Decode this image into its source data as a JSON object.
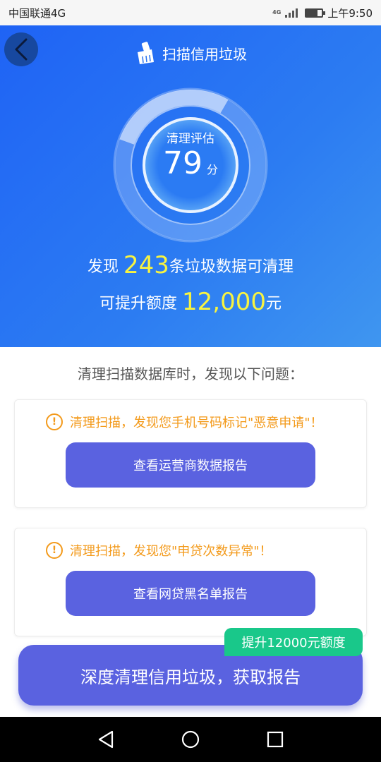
{
  "status_bar": {
    "carrier": "中国联通4G",
    "network_type": "4G",
    "battery_level": 0.7,
    "time": "上午9:50"
  },
  "header": {
    "title": "扫描信用垃圾",
    "icon": "broom-icon",
    "back_icon": "chevron-left-icon"
  },
  "gauge": {
    "label": "清理评估",
    "score": "79",
    "unit": "分"
  },
  "summary": {
    "found_prefix": "发现",
    "found_count": "243",
    "found_suffix": "条垃圾数据可清理",
    "credit_prefix": "可提升额度",
    "credit_amount": "12,000",
    "credit_suffix": "元"
  },
  "section_title": "清理扫描数据库时，发现以下问题：",
  "issues": [
    {
      "warning": "清理扫描，发现您手机号码标记\"恶意申请\"！",
      "button": "查看运营商数据报告"
    },
    {
      "warning": "清理扫描，发现您\"申贷次数异常\"！",
      "button": "查看网贷黑名单报告"
    }
  ],
  "cta": {
    "label": "深度清理信用垃圾，获取报告",
    "badge": "提升12000元额度"
  },
  "colors": {
    "hero_start": "#1f63f5",
    "hero_end": "#3f96f0",
    "highlight": "#f7f341",
    "button": "#5a62e0",
    "warning": "#f39a1b",
    "badge": "#19c88a"
  },
  "nav": [
    "back-triangle-icon",
    "home-circle-icon",
    "recents-square-icon"
  ]
}
